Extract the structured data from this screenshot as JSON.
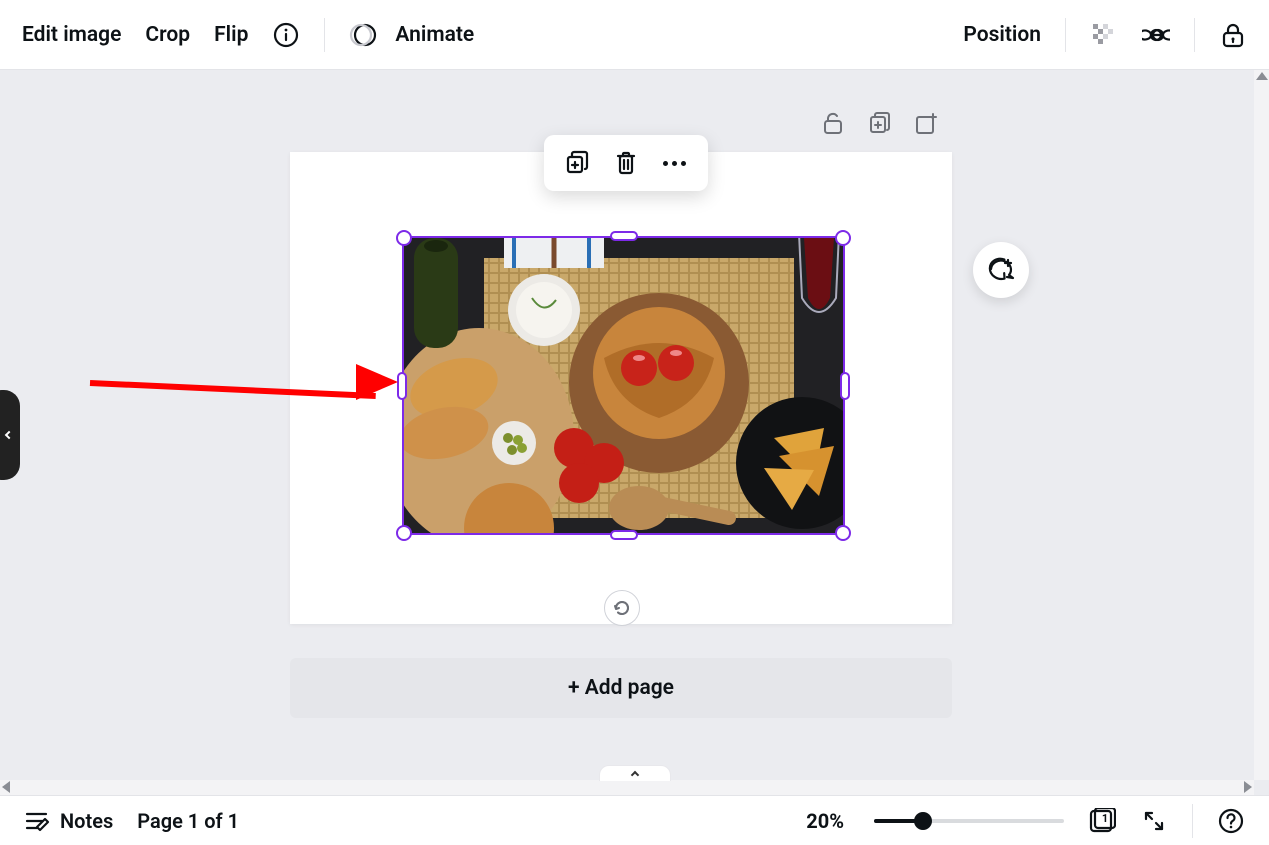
{
  "toolbar": {
    "edit_image": "Edit image",
    "crop": "Crop",
    "flip": "Flip",
    "animate": "Animate",
    "position": "Position"
  },
  "canvas": {
    "add_page_label": "+ Add page",
    "selected_element": "food-image",
    "annotation_arrow_target": "resize-handle-left"
  },
  "context_toolbar": {
    "actions": [
      "duplicate",
      "delete",
      "more"
    ]
  },
  "page_actions": [
    "unlock",
    "duplicate-page",
    "add-page-above"
  ],
  "footer": {
    "notes_label": "Notes",
    "page_indicator": "Page 1 of 1",
    "zoom_percent": "20%",
    "zoom_slider_value": 20,
    "zoom_slider_max": 100,
    "page_count_badge": "1"
  }
}
